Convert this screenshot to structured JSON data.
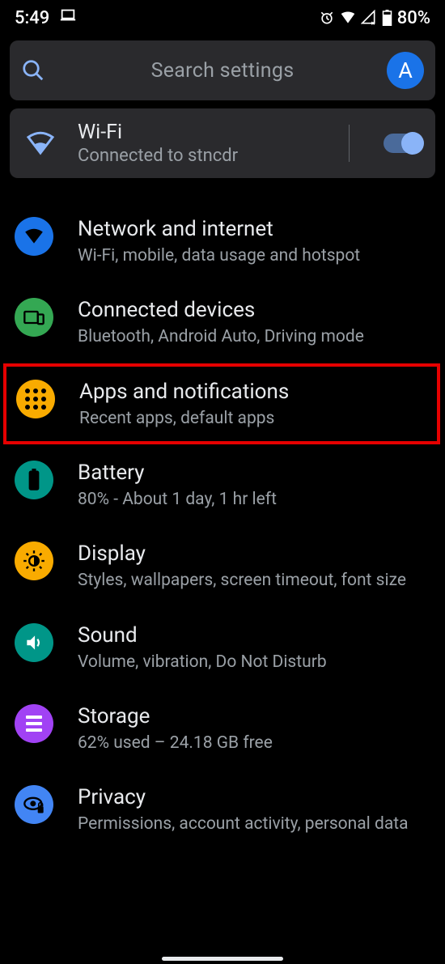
{
  "status": {
    "time": "5:49",
    "battery": "80%"
  },
  "search": {
    "placeholder": "Search settings",
    "avatar_letter": "A"
  },
  "wifi_tile": {
    "title": "Wi-Fi",
    "subtitle": "Connected to stncdr",
    "enabled": true
  },
  "items": [
    {
      "id": "network",
      "title": "Network and internet",
      "subtitle": "Wi-Fi, mobile, data usage and hotspot",
      "icon": "wifi-icon",
      "bg": "bg-blue"
    },
    {
      "id": "devices",
      "title": "Connected devices",
      "subtitle": "Bluetooth, Android Auto, Driving mode",
      "icon": "devices-icon",
      "bg": "bg-green"
    },
    {
      "id": "apps",
      "title": "Apps and notifications",
      "subtitle": "Recent apps, default apps",
      "icon": "apps-icon",
      "bg": "bg-orange",
      "highlighted": true
    },
    {
      "id": "battery",
      "title": "Battery",
      "subtitle": "80% - About 1 day, 1 hr left",
      "icon": "battery-icon",
      "bg": "bg-teal"
    },
    {
      "id": "display",
      "title": "Display",
      "subtitle": "Styles, wallpapers, screen timeout, font size",
      "icon": "display-icon",
      "bg": "bg-orange"
    },
    {
      "id": "sound",
      "title": "Sound",
      "subtitle": "Volume, vibration, Do Not Disturb",
      "icon": "sound-icon",
      "bg": "bg-teal"
    },
    {
      "id": "storage",
      "title": "Storage",
      "subtitle": "62% used – 24.18 GB free",
      "icon": "storage-icon",
      "bg": "bg-purple"
    },
    {
      "id": "privacy",
      "title": "Privacy",
      "subtitle": "Permissions, account activity, personal data",
      "icon": "privacy-icon",
      "bg": "bg-blue2"
    }
  ]
}
